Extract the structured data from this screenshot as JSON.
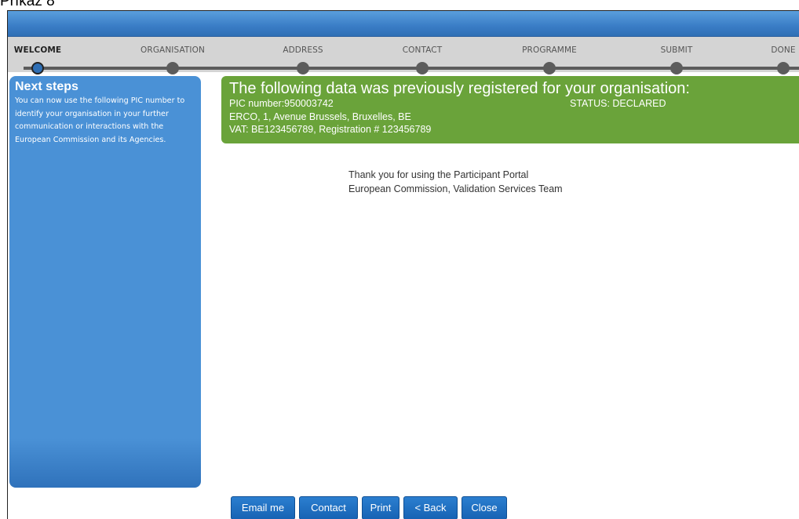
{
  "caption": "Příkaz 8",
  "steps": [
    {
      "label": "WELCOME",
      "active": true
    },
    {
      "label": "ORGANISATION",
      "active": false
    },
    {
      "label": "ADDRESS",
      "active": false
    },
    {
      "label": "CONTACT",
      "active": false
    },
    {
      "label": "PROGRAMME",
      "active": false
    },
    {
      "label": "SUBMIT",
      "active": false
    },
    {
      "label": "DONE",
      "active": false
    }
  ],
  "sidebar": {
    "title": "Next steps",
    "text": "You can now use the following PIC number to identify your organisation in your further communication or interactions with the European Commission and its Agencies."
  },
  "organisation_box": {
    "title": "The following data was previously registered for your organisation:",
    "pic": "PIC number:950003742",
    "status": "STATUS: DECLARED",
    "address": "ERCO, 1, Avenue Brussels, Bruxelles, BE",
    "vat": "VAT: BE123456789, Registration # 123456789"
  },
  "thanks": {
    "line1": "Thank you for using the Participant Portal",
    "line2": "European Commission, Validation Services Team"
  },
  "buttons": {
    "email": "Email me",
    "contact": "Contact",
    "print": "Print",
    "back": "< Back",
    "close": "Close"
  },
  "colors": {
    "accent": "#3a7dc6",
    "green": "#6aa33a",
    "sidebar": "#4a91d6"
  }
}
